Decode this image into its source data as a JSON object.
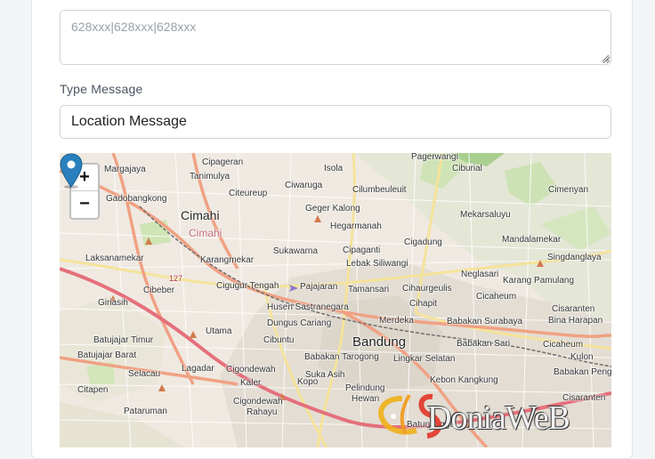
{
  "form": {
    "numbers_placeholder": "628xxx|628xxx|628xxx",
    "type_label": "Type Message",
    "type_value": "Location Message"
  },
  "map": {
    "zoom_in": "+",
    "zoom_out": "−",
    "labels": {
      "pagerwangi": "Pagerwangi",
      "margajaya": "Margajaya",
      "cipageran": "Cipageran",
      "isola": "Isola",
      "ciburial": "Ciburial",
      "tanimulya": "Tanimulya",
      "gadobangkong": "Gadobangkong",
      "citeureup": "Citeureup",
      "ciwaruga": "Ciwaruga",
      "cilumbeuleuit": "Cilumbeuleuit",
      "cimenyan": "Cimenyan",
      "geger_kalong": "Geger Kalong",
      "mekarsaluyu": "Mekarsaluyu",
      "cimahi": "Cimahi",
      "cimahi_alt": "Cimahi",
      "hegarmanah": "Hegarmanah",
      "mandalamekar": "Mandalamekar",
      "cigadung": "Cigadung",
      "laksanamekar": "Laksanamekar",
      "karangmekar": "Karangmekar",
      "sukawarna": "Sukawarna",
      "cipaganti": "Cipaganti",
      "singdanglaya": "Singdanglaya",
      "lebak_siliwangi": "Lebak Siliwangi",
      "neglasari": "Neglasari",
      "karang_pamulang": "Karang Pamulang",
      "cibeber": "Cibeber",
      "cigugur_tengah": "Cigugur Tengah",
      "pajajaran": "Pajajaran",
      "tamansari": "Tamansari",
      "cihaurgeulis": "Cihaurgeulis",
      "cicaheum": "Cicaheum",
      "giriasih": "Giriasih",
      "husen_sastranegara": "Husen Sastranegara",
      "cihapit": "Cihapit",
      "cisaranten": "Cisaranten",
      "merdeka": "Merdeka",
      "babakan_surabaya": "Babakan Surabaya",
      "bina_harapan": "Bina Harapan",
      "dungus_cariang": "Dungus Cariang",
      "utama": "Utama",
      "batujajar_timur": "Batujajar Timur",
      "cibuntu": "Cibuntu",
      "bandung": "Bandung",
      "babakan_sari": "Babakan Sari",
      "cicaheum2": "Cicaheum",
      "batujajar_barat": "Batujajar Barat",
      "babakan_tarogong": "Babakan Tarogong",
      "lingkar_selatan": "Lingkar Selatan",
      "kulon": "Kulon",
      "babakan_penghulu": "Babakan Penghulu",
      "lagadar": "Lagadar",
      "cigondewah": "Cigondewah",
      "selacau": "Selacau",
      "kaler": "Kaler",
      "kopo": "Kopo",
      "suka_asih": "Suka Asih",
      "kebon_kangkung": "Kebon Kangkung",
      "citapen": "Citapen",
      "pelindung": "Pelindung",
      "hewan": "Hewan",
      "cisaranten2": "Cisaranten",
      "cigondewah2": "Cigondewah",
      "rahayu": "Rahayu",
      "pataruman": "Pataruman",
      "batununggal": "Batununggal",
      "road_127": "127"
    }
  },
  "watermark": {
    "text": "DoniaWeB"
  }
}
